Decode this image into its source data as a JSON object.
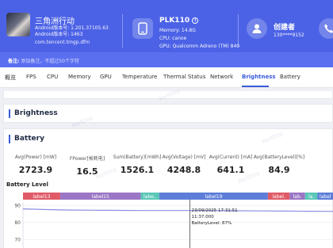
{
  "app": {
    "name": "三角洲行动",
    "android_version": "Android版本号: 1.201.37105.63",
    "android_code": "Android版本号: 1463",
    "package": "com.tencent.tmgp.dfm"
  },
  "device": {
    "model": "PLK110",
    "model_badge": "i",
    "memory": "Memory: 14.8G",
    "cpu": "CPU: canoe",
    "gpu": "GPU: Qualcomm Adreno (TM) 840"
  },
  "user": {
    "name": "创建者",
    "phone": "130****9152"
  },
  "note": {
    "label": "备注:",
    "value": "添加备注，不超过50个字符"
  },
  "tabs": [
    "概览",
    "FPS",
    "CPU",
    "Memory",
    "GPU",
    "Temperature",
    "Thermal Status",
    "Network",
    "Brightness",
    "Battery"
  ],
  "active_tab": "Brightness",
  "sections": {
    "brightness": "Brightness",
    "battery": "Battery"
  },
  "stats": [
    {
      "label": "Avg(Power) [mW]",
      "value": "2723.9"
    },
    {
      "label": "FPower[帧耗电]",
      "value": "16.5"
    },
    {
      "label": "Sum(Battery)[mWh]",
      "value": "1526.1"
    },
    {
      "label": "Avg(Voltage) [mV]",
      "value": "4248.8"
    },
    {
      "label": "Avg(Current) [mA]",
      "value": "641.1"
    },
    {
      "label": "Avg(BatteryLevel)[%]",
      "value": "84.9"
    }
  ],
  "chart_title": "Battery Level",
  "watermark": "PerfDog",
  "colors": {
    "header": "#4c62e6",
    "accent": "#3b5bdb",
    "line": "#8a8fe0"
  },
  "chart_data": {
    "type": "line",
    "title": "Battery Level",
    "y_ticks": [
      90,
      80,
      70
    ],
    "ylim": [
      65,
      92
    ],
    "series": [
      {
        "values": [
          88,
          87.6,
          87.3,
          87.2,
          87.1,
          87.0,
          87.0,
          87.0,
          87.0,
          86.9,
          86.8,
          86.7,
          86.6,
          86.5
        ]
      }
    ],
    "labels": [
      {
        "name": "label13",
        "color": "#e05a68",
        "start": 0.0,
        "end": 0.12
      },
      {
        "name": "label15",
        "color": "#9a76c4",
        "start": 0.12,
        "end": 0.38
      },
      {
        "name": "labe..",
        "color": "#5bc7b8",
        "start": 0.38,
        "end": 0.44
      },
      {
        "name": "label19",
        "color": "#5c7ed8",
        "start": 0.44,
        "end": 0.79
      },
      {
        "name": "label.",
        "color": "#e05a68",
        "start": 0.79,
        "end": 0.86
      },
      {
        "name": "lab.",
        "color": "#9a76c4",
        "start": 0.86,
        "end": 0.91
      },
      {
        "name": "la.",
        "color": "#5bc7b8",
        "start": 0.91,
        "end": 0.95
      },
      {
        "name": "label",
        "color": "#5c7ed8",
        "start": 0.95,
        "end": 1.0
      }
    ],
    "cursor": {
      "index": 7,
      "time": "23/09/2025 17:31:51",
      "frame": "11:37:000",
      "text": "BatteryLevel: 87%"
    }
  }
}
